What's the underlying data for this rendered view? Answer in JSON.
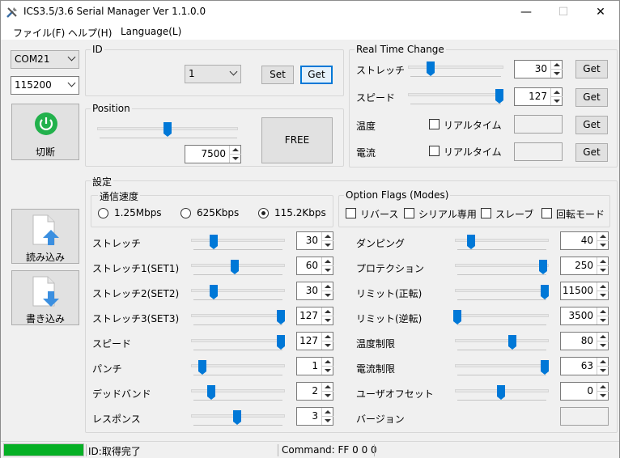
{
  "window": {
    "title": "ICS3.5/3.6 Serial Manager  Ver 1.1.0.0",
    "app_icon": "tools-icon"
  },
  "menu": [
    "ファイル(F)",
    "ヘルプ(H)",
    "Language(L)"
  ],
  "port": {
    "com": "COM21",
    "baud": "115200"
  },
  "connect_button": {
    "label": "切断",
    "icon": "power-icon",
    "color": "#22b14c"
  },
  "read_button": {
    "label": "読み込み",
    "icon": "file-upload-icon"
  },
  "write_button": {
    "label": "書き込み",
    "icon": "file-download-icon"
  },
  "id_group": {
    "label": "ID",
    "value": "1",
    "set": "Set",
    "get": "Get"
  },
  "position_group": {
    "label": "Position",
    "value": "7500",
    "slider": 0.5,
    "free": "FREE"
  },
  "realtime": {
    "label": "Real Time Change",
    "stretch": {
      "label": "ストレッチ",
      "value": "30",
      "slider": 0.23,
      "get": "Get"
    },
    "speed": {
      "label": "スピード",
      "value": "127",
      "slider": 1.0,
      "get": "Get"
    },
    "temp": {
      "label": "温度",
      "check": "リアルタイム",
      "get": "Get"
    },
    "current": {
      "label": "電流",
      "check": "リアルタイム",
      "get": "Get"
    }
  },
  "settings": {
    "label": "設定",
    "comm": {
      "label": "通信速度",
      "options": [
        "1.25Mbps",
        "625Kbps",
        "115.2Kbps"
      ],
      "selected": 2
    },
    "flags": {
      "label": "Option Flags (Modes)",
      "items": [
        "リバース",
        "シリアル専用",
        "スレーブ",
        "回転モード"
      ]
    },
    "left": [
      {
        "label": "ストレッチ",
        "value": "30",
        "slider": 0.23
      },
      {
        "label": "ストレッチ1(SET1)",
        "value": "60",
        "slider": 0.47
      },
      {
        "label": "ストレッチ2(SET2)",
        "value": "30",
        "slider": 0.23
      },
      {
        "label": "ストレッチ3(SET3)",
        "value": "127",
        "slider": 1.0
      },
      {
        "label": "スピード",
        "value": "127",
        "slider": 1.0
      },
      {
        "label": "パンチ",
        "value": "1",
        "slider": 0.1
      },
      {
        "label": "デッドバンド",
        "value": "2",
        "slider": 0.2
      },
      {
        "label": "レスポンス",
        "value": "3",
        "slider": 0.5
      }
    ],
    "right": [
      {
        "label": "ダンピング",
        "value": "40",
        "slider": 0.16
      },
      {
        "label": "プロテクション",
        "value": "250",
        "slider": 0.98
      },
      {
        "label": "リミット(正転)",
        "value": "11500",
        "slider": 1.0
      },
      {
        "label": "リミット(逆転)",
        "value": "3500",
        "slider": 0.0
      },
      {
        "label": "温度制限",
        "value": "80",
        "slider": 0.63
      },
      {
        "label": "電流制限",
        "value": "63",
        "slider": 1.0
      },
      {
        "label": "ユーザオフセット",
        "value": "0",
        "slider": 0.5
      },
      {
        "label": "バージョン",
        "value": "",
        "slider": null
      }
    ]
  },
  "status": {
    "progress": 1.0,
    "text": "ID:取得完了",
    "command": "Command: FF 0 0 0"
  }
}
